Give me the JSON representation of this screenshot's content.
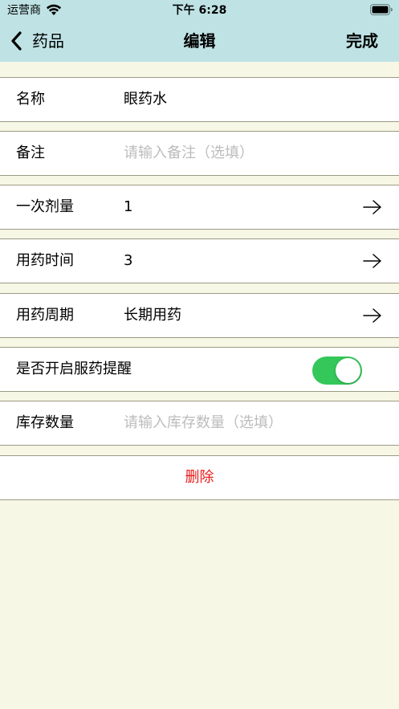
{
  "status_bar": {
    "carrier": "运营商",
    "time": "下午 6:28"
  },
  "nav": {
    "back_label": "药品",
    "title": "编辑",
    "done_label": "完成"
  },
  "colors": {
    "header_bg": "#bfe3e5",
    "page_bg": "#f7f7e5",
    "toggle_on": "#34c759",
    "delete_red": "#e81b1b",
    "placeholder_gray": "#bcbcbc"
  },
  "form": {
    "name": {
      "label": "名称",
      "value": "眼药水"
    },
    "note": {
      "label": "备注",
      "placeholder": "请输入备注（选填）"
    },
    "dose": {
      "label": "一次剂量",
      "value": "1",
      "icon": "arrow-right-icon"
    },
    "time": {
      "label": "用药时间",
      "value": "3",
      "icon": "arrow-right-icon"
    },
    "period": {
      "label": "用药周期",
      "value": "长期用药",
      "icon": "arrow-right-icon"
    },
    "reminder": {
      "label": "是否开启服药提醒",
      "enabled": true
    },
    "stock": {
      "label": "库存数量",
      "placeholder": "请输入库存数量（选填）"
    },
    "delete_label": "删除"
  }
}
